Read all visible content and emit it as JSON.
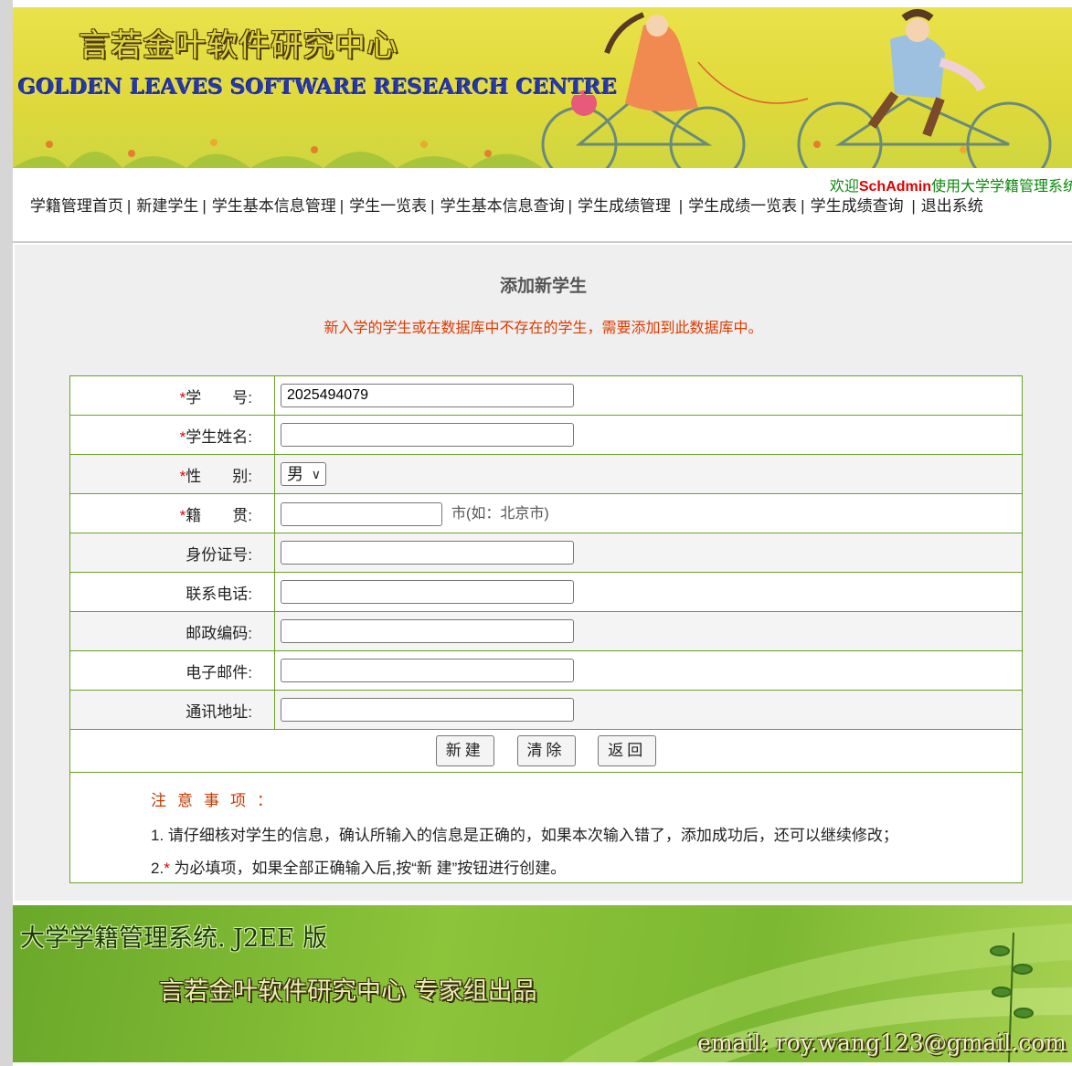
{
  "banner": {
    "title_cn": "言若金叶软件研究中心",
    "title_en": "GOLDEN LEAVES SOFTWARE RESEARCH CENTRE"
  },
  "welcome": {
    "prefix": "欢迎",
    "user": "SchAdmin",
    "suffix": "使用大学学籍管理系统"
  },
  "nav": {
    "items": [
      {
        "label": "学籍管理首页"
      },
      {
        "label": "新建学生"
      },
      {
        "label": "学生基本信息管理"
      },
      {
        "label": "学生一览表"
      },
      {
        "label": "学生基本信息查询"
      },
      {
        "label": "学生成绩管理"
      },
      {
        "label": "学生成绩一览表"
      },
      {
        "label": "学生成绩查询"
      },
      {
        "label": "退出系统"
      }
    ],
    "separator": "|"
  },
  "form": {
    "title": "添加新学生",
    "subtitle": "新入学的学生或在数据库中不存在的学生，需要添加到此数据库中。",
    "required_mark": "*",
    "fields": {
      "student_id": {
        "label": "学　　号:",
        "value": "2025494079"
      },
      "name": {
        "label": "学生姓名:",
        "value": ""
      },
      "gender": {
        "label": "性　　别:",
        "value": "男"
      },
      "hometown": {
        "label": "籍　　贯:",
        "value": "",
        "hint": "市(如：北京市)"
      },
      "id_card": {
        "label": "身份证号:",
        "value": ""
      },
      "phone": {
        "label": "联系电话:",
        "value": ""
      },
      "postcode": {
        "label": "邮政编码:",
        "value": ""
      },
      "email": {
        "label": "电子邮件:",
        "value": ""
      },
      "address": {
        "label": "通讯地址:",
        "value": ""
      }
    },
    "buttons": {
      "create": "新建",
      "clear": "清除",
      "back": "返回"
    },
    "notes": {
      "title": "注意事项：",
      "note1": "1. 请仔细核对学生的信息，确认所输入的信息是正确的，如果本次输入错了，添加成功后，还可以继续修改；",
      "note2_prefix": "2.",
      "note2_text": " 为必填项，如果全部正确输入后,按“新 建”按钮进行创建。"
    }
  },
  "footer": {
    "title": "大学学籍管理系统. J2EE 版",
    "org": "言若金叶软件研究中心 专家组出品",
    "email": "email: roy.wang123@gmail.com"
  },
  "colors": {
    "accent_green": "#6aa02a",
    "required_red": "#e00000",
    "notice_orange": "#e03a00",
    "welcome_green": "#0a8a0a"
  }
}
